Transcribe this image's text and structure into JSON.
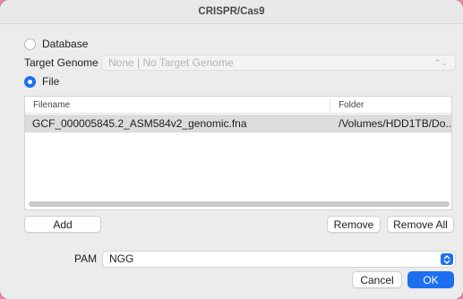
{
  "window": {
    "title": "CRISPR/Cas9"
  },
  "source": {
    "database_label": "Database",
    "file_label": "File",
    "selected": "file"
  },
  "target_genome": {
    "label": "Target Genome",
    "value": "None | No Target Genome"
  },
  "files_table": {
    "columns": [
      "Filename",
      "Folder"
    ],
    "rows": [
      {
        "filename": "GCF_000005845.2_ASM584v2_genomic.fna",
        "folder": "/Volumes/HDD1TB/Do..."
      }
    ]
  },
  "buttons": {
    "add": "Add",
    "remove": "Remove",
    "remove_all": "Remove All",
    "cancel": "Cancel",
    "ok": "OK"
  },
  "pam": {
    "label": "PAM",
    "value": "NGG"
  },
  "colors": {
    "accent": "#1e6ff0",
    "desktop": "#e58aa0"
  }
}
